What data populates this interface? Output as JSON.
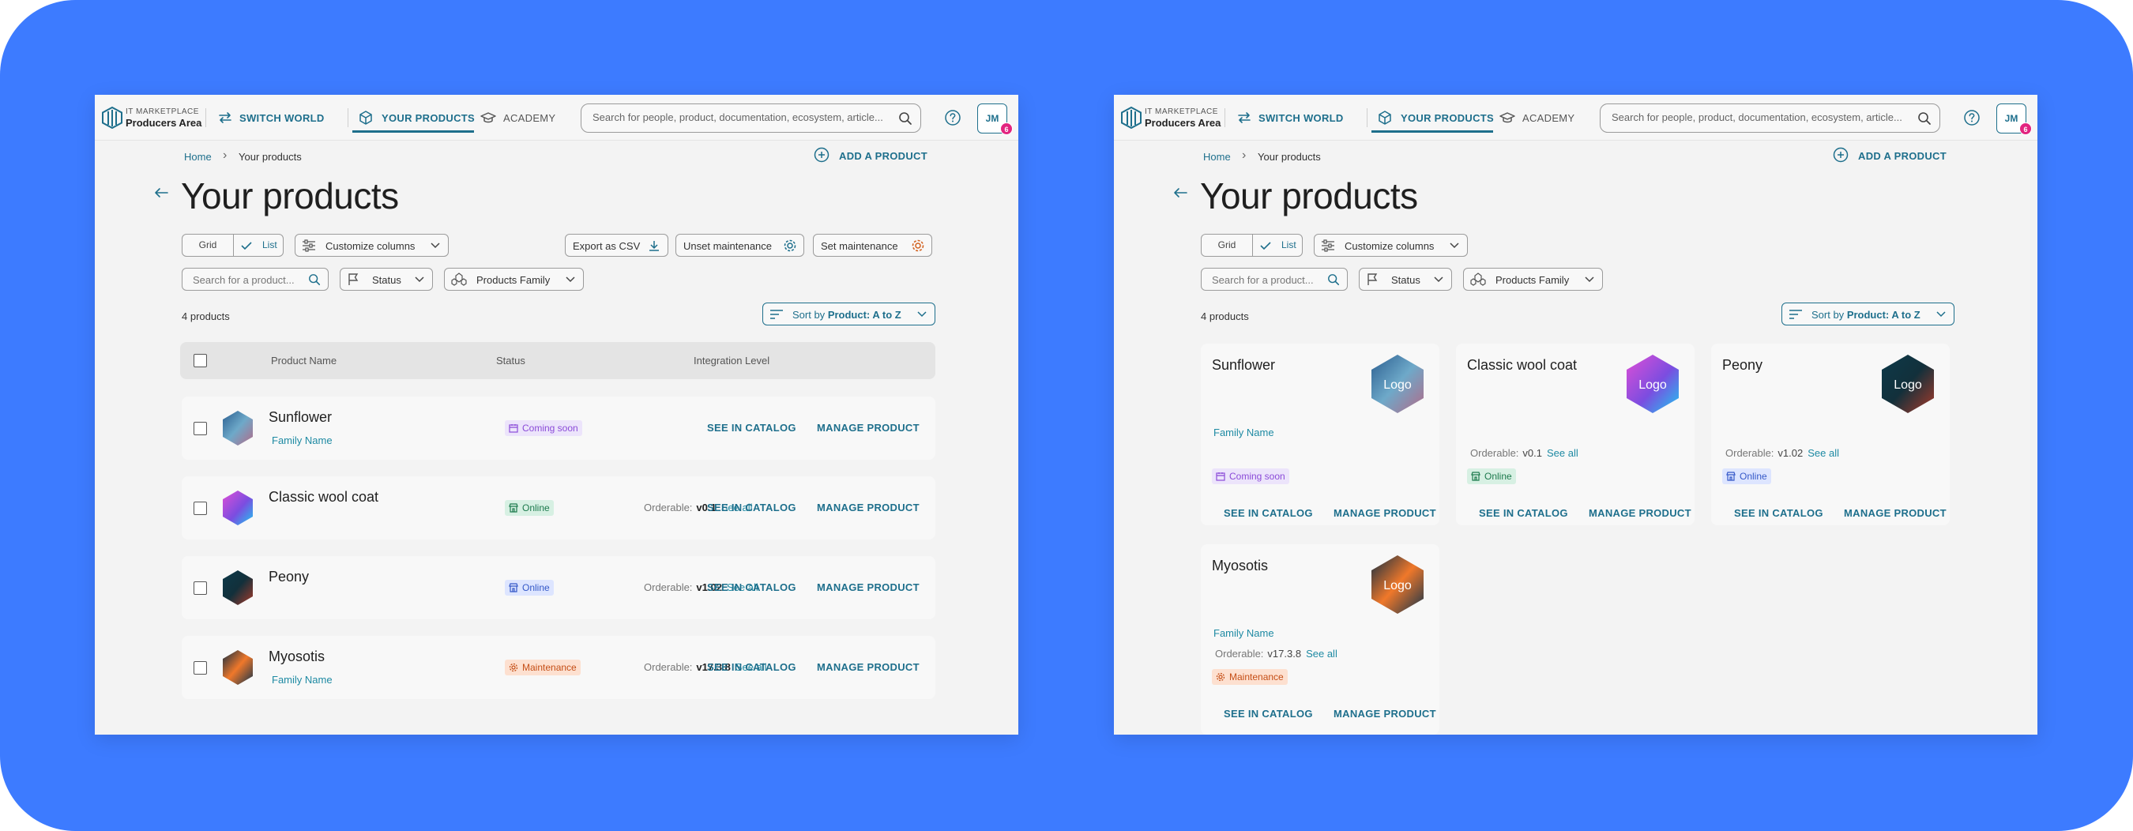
{
  "nav": {
    "brand_top": "IT MARKETPLACE",
    "brand_bottom": "Producers Area",
    "switch_world": "SWITCH WORLD",
    "your_products": "YOUR PRODUCTS",
    "academy": "ACADEMY",
    "search_placeholder": "Search for people, product, documentation, ecosystem, article...",
    "avatar_initials": "JM",
    "avatar_badge": "6"
  },
  "breadcrumb": {
    "home": "Home",
    "current": "Your products"
  },
  "add_product": "ADD A PRODUCT",
  "page_title": "Your products",
  "toolbar": {
    "grid": "Grid",
    "list": "List",
    "customize_columns": "Customize columns",
    "export_csv": "Export as CSV",
    "unset_maintenance": "Unset maintenance",
    "set_maintenance": "Set maintenance",
    "search_placeholder": "Search for a product...",
    "status_filter": "Status",
    "family_filter": "Products Family",
    "sort_prefix": "Sort by",
    "sort_value": "Product: A to Z",
    "count": "4 products"
  },
  "table_headers": {
    "name": "Product Name",
    "status": "Status",
    "integration": "Integration Level"
  },
  "products": [
    {
      "name": "Sunflower",
      "family": "Family Name",
      "status": "Coming soon",
      "orderable_label": "",
      "version": "",
      "see_all": "",
      "catalog": "SEE IN CATALOG",
      "manage": "MANAGE PRODUCT",
      "logo": "Logo"
    },
    {
      "name": "Classic wool coat",
      "family": "",
      "status": "Online",
      "orderable_label": "Orderable:",
      "version": "v0.1",
      "see_all": "See all",
      "catalog": "SEE IN CATALOG",
      "manage": "MANAGE PRODUCT",
      "logo": "Logo"
    },
    {
      "name": "Peony",
      "family": "",
      "status": "Online",
      "orderable_label": "Orderable:",
      "version": "v1.02",
      "see_all": "See all",
      "catalog": "SEE IN CATALOG",
      "manage": "MANAGE PRODUCT",
      "logo": "Logo"
    },
    {
      "name": "Myosotis",
      "family": "Family Name",
      "status": "Maintenance",
      "orderable_label": "Orderable:",
      "version": "v17.3.8",
      "see_all": "See all",
      "catalog": "SEE IN CATALOG",
      "manage": "MANAGE PRODUCT",
      "logo": "Logo"
    }
  ],
  "colors": {
    "canvas": "#3d7bff",
    "accent": "#1e6f8c",
    "coming_soon": "#8b4bd8",
    "online_green": "#1d7a4d",
    "online_blue": "#3559c8",
    "maintenance": "#c54e16"
  },
  "icons": [
    "logo-mark-icon",
    "switch-world-icon",
    "cube-icon",
    "academy-cap-icon",
    "search-icon",
    "help-icon",
    "add-circle-icon",
    "back-arrow-icon",
    "check-icon",
    "sliders-icon",
    "chevron-down-icon",
    "download-icon",
    "gear-icon",
    "flag-icon",
    "family-icon",
    "sort-icon",
    "calendar-icon",
    "store-icon"
  ]
}
